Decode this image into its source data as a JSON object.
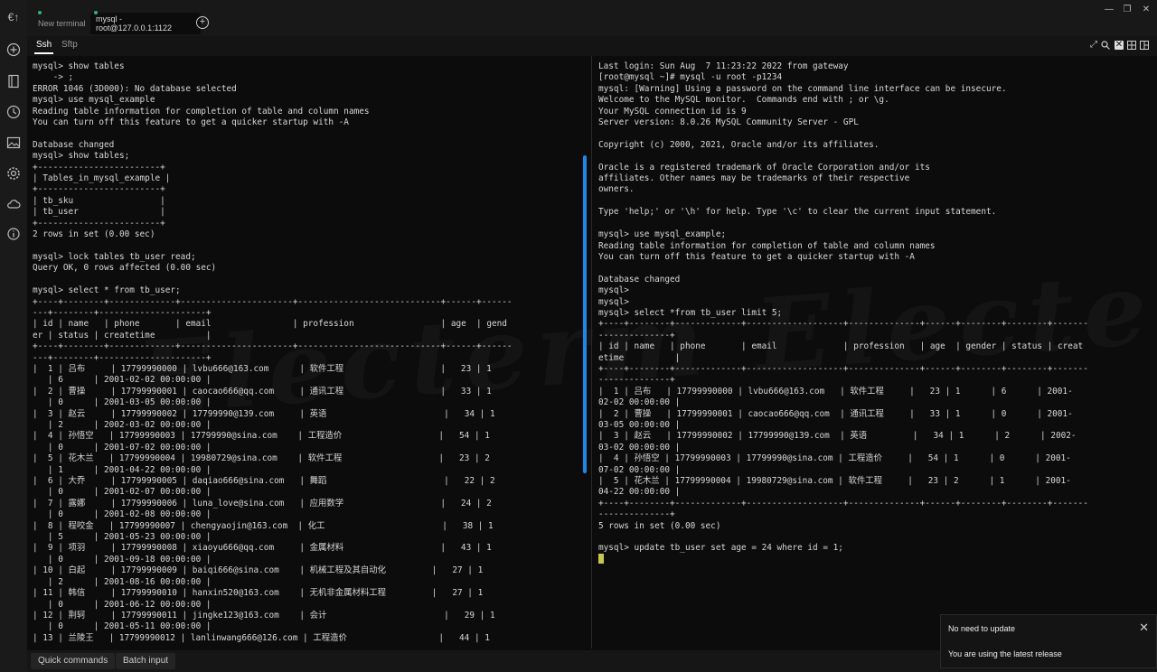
{
  "rail": {
    "logo": "€↑",
    "icons": [
      "plus-icon",
      "book-icon",
      "clock-icon",
      "image-icon",
      "gear-icon",
      "cloud-icon",
      "info-icon"
    ]
  },
  "tabs": [
    {
      "label": "New terminal"
    },
    {
      "label": "mysql - root@127.0.0.1:1122"
    }
  ],
  "subtabs": [
    "Ssh",
    "Sftp"
  ],
  "left_terminal": "mysql> show tables\n    -> ;\nERROR 1046 (3D000): No database selected\nmysql> use mysql_example\nReading table information for completion of table and column names\nYou can turn off this feature to get a quicker startup with -A\n\nDatabase changed\nmysql> show tables;\n+------------------------+\n| Tables_in_mysql_example |\n+------------------------+\n| tb_sku                 |\n| tb_user                |\n+------------------------+\n2 rows in set (0.00 sec)\n\nmysql> lock tables tb_user read;\nQuery OK, 0 rows affected (0.00 sec)\n\nmysql> select * from tb_user;\n+----+--------+-------------+----------------------+----------------------------+------+------\n---+--------+---------------------+\n| id | name   | phone       | email                | profession                 | age  | gend\ner | status | createtime          |\n+----+--------+-------------+----------------------+----------------------------+------+------\n---+--------+---------------------+\n|  1 | 吕布     | 17799990000 | lvbu666@163.com      | 软件工程                   |   23 | 1\n   | 6      | 2001-02-02 00:00:00 |\n|  2 | 曹操     | 17799990001 | caocao666@qq.com     | 通讯工程                   |   33 | 1\n   | 0      | 2001-03-05 00:00:00 |\n|  3 | 赵云     | 17799990002 | 17799990@139.com     | 英语                       |   34 | 1\n   | 2      | 2002-03-02 00:00:00 |\n|  4 | 孙悟空   | 17799990003 | 17799990@sina.com    | 工程造价                   |   54 | 1\n   | 0      | 2001-07-02 00:00:00 |\n|  5 | 花木兰   | 17799990004 | 19980729@sina.com    | 软件工程                   |   23 | 2\n   | 1      | 2001-04-22 00:00:00 |\n|  6 | 大乔     | 17799990005 | daqiao666@sina.com   | 舞蹈                       |   22 | 2\n   | 0      | 2001-02-07 00:00:00 |\n|  7 | 露娜     | 17799990006 | luna_love@sina.com   | 应用数学                   |   24 | 2\n   | 0      | 2001-02-08 00:00:00 |\n|  8 | 程咬金   | 17799990007 | chengyaojin@163.com  | 化工                       |   38 | 1\n   | 5      | 2001-05-23 00:00:00 |\n|  9 | 项羽     | 17799990008 | xiaoyu666@qq.com     | 金属材料                   |   43 | 1\n   | 0      | 2001-09-18 00:00:00 |\n| 10 | 白起     | 17799990009 | baiqi666@sina.com    | 机械工程及其自动化         |   27 | 1\n   | 2      | 2001-08-16 00:00:00 |\n| 11 | 韩信     | 17799990010 | hanxin520@163.com    | 无机非金属材料工程         |   27 | 1\n   | 0      | 2001-06-12 00:00:00 |\n| 12 | 荆轲     | 17799990011 | jingke123@163.com    | 会计                       |   29 | 1\n   | 0      | 2001-05-11 00:00:00 |\n| 13 | 兰陵王   | 17799990012 | lanlinwang666@126.com | 工程造价                  |   44 | 1",
  "right_terminal": "Last login: Sun Aug  7 11:23:22 2022 from gateway\n[root@mysql ~]# mysql -u root -p1234\nmysql: [Warning] Using a password on the command line interface can be insecure.\nWelcome to the MySQL monitor.  Commands end with ; or \\g.\nYour MySQL connection id is 9\nServer version: 8.0.26 MySQL Community Server - GPL\n\nCopyright (c) 2000, 2021, Oracle and/or its affiliates.\n\nOracle is a registered trademark of Oracle Corporation and/or its\naffiliates. Other names may be trademarks of their respective\nowners.\n\nType 'help;' or '\\h' for help. Type '\\c' to clear the current input statement.\n\nmysql> use mysql_example;\nReading table information for completion of table and column names\nYou can turn off this feature to get a quicker startup with -A\n\nDatabase changed\nmysql>\nmysql>\nmysql> select *from tb_user limit 5;\n+----+--------+-------------+-------------------+--------------+------+--------+--------+-------\n--------------+\n| id | name   | phone       | email             | profession   | age  | gender | status | creat\netime          |\n+----+--------+-------------+-------------------+--------------+------+--------+--------+-------\n--------------+\n|  1 | 吕布   | 17799990000 | lvbu666@163.com   | 软件工程     |   23 | 1      | 6      | 2001-\n02-02 00:00:00 |\n|  2 | 曹操   | 17799990001 | caocao666@qq.com  | 通讯工程     |   33 | 1      | 0      | 2001-\n03-05 00:00:00 |\n|  3 | 赵云   | 17799990002 | 17799990@139.com  | 英语         |   34 | 1      | 2      | 2002-\n03-02 00:00:00 |\n|  4 | 孙悟空 | 17799990003 | 17799990@sina.com | 工程造价     |   54 | 1      | 0      | 2001-\n07-02 00:00:00 |\n|  5 | 花木兰 | 17799990004 | 19980729@sina.com | 软件工程     |   23 | 2      | 1      | 2001-\n04-22 00:00:00 |\n+----+--------+-------------+-------------------+--------------+------+--------+--------+-------\n--------------+\n5 rows in set (0.00 sec)\n\nmysql> update tb_user set age = 24 where id = 1;",
  "bottom_buttons": [
    "Quick commands",
    "Batch input"
  ],
  "toast": {
    "title": "No need to update",
    "message": "You are using the latest release"
  },
  "watermark": "Electerm  Electerm",
  "colors": {
    "accent": "#1e88e5",
    "cursor": "#c8c850",
    "tab_status": "#2bb673"
  }
}
